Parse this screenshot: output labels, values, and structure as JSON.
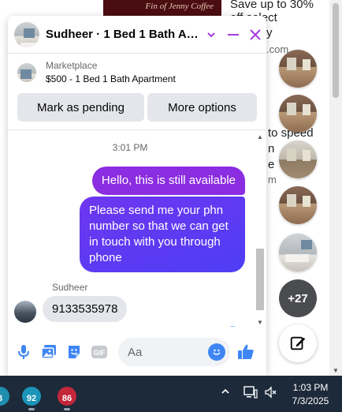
{
  "background": {
    "banner_text": "Fin of Jenny Coffee",
    "lines": [
      "Save up to 30%",
      "off select",
      "y",
      ".com",
      "to speed",
      "n",
      "e",
      "m"
    ]
  },
  "chat_heads": {
    "more_count": "+27"
  },
  "chat": {
    "title": "Sudheer · 1 Bed 1 Bath Apa...",
    "listing": {
      "kind": "Marketplace",
      "title": "$500 - 1 Bed 1 Bath Apartment"
    },
    "actions": {
      "mark_pending": "Mark as pending",
      "more_options": "More options"
    },
    "timestamp": "3:01 PM",
    "messages": [
      {
        "from": "me",
        "text": "Hello, this is still available"
      },
      {
        "from": "me",
        "text": "Please send me your phn number so that we can get in touch with you through phone"
      },
      {
        "from": "Sudheer",
        "text": "9133535978"
      }
    ],
    "sender_name": "Sudheer",
    "composer": {
      "placeholder": "Aa"
    }
  },
  "taskbar": {
    "apps": [
      {
        "badge": "3",
        "color": "#1f8fb0"
      },
      {
        "badge": "92",
        "color": "#1c94b8"
      },
      {
        "badge": "86",
        "color": "#c2273a"
      }
    ],
    "time": "1:03 PM",
    "date": "7/3/2025"
  },
  "colors": {
    "accent": "#a43be0",
    "sent_bubble": "#8b2de0",
    "sent_gradient_end": "#4e3ef5",
    "like_blue": "#3f86f5"
  }
}
